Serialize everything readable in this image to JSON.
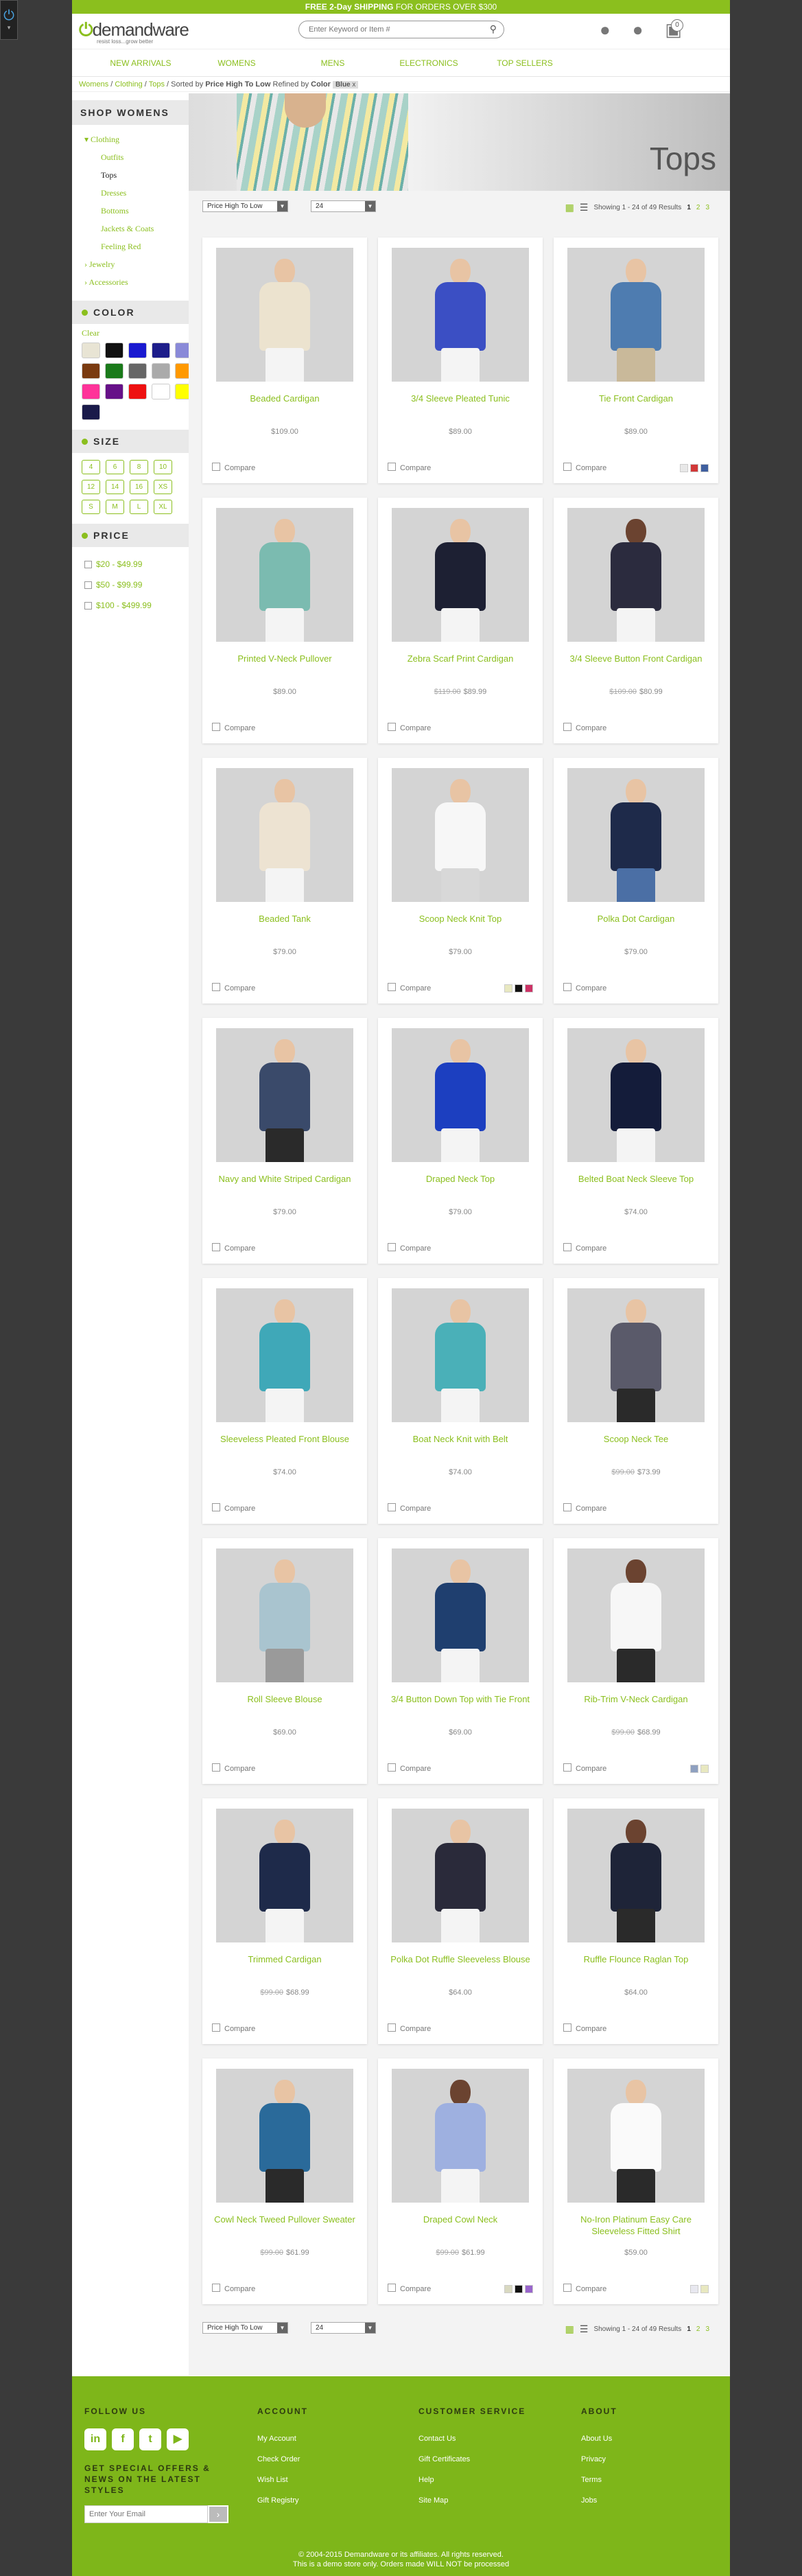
{
  "promo": {
    "bold": "FREE 2-Day SHIPPING",
    "text": " FOR ORDERS OVER $300"
  },
  "logo": {
    "brand": "demandware",
    "tagline": "resist loss...grow better"
  },
  "search": {
    "placeholder": "Enter Keyword or Item #"
  },
  "cart": {
    "count": "0"
  },
  "nav": [
    "NEW ARRIVALS",
    "WOMENS",
    "MENS",
    "ELECTRONICS",
    "TOP SELLERS"
  ],
  "breadcrumb": {
    "items": [
      "Womens",
      "Clothing",
      "Tops"
    ],
    "sorted_label": "Sorted by",
    "sorted_value": "Price High To Low",
    "refined_label": "Refined by",
    "refined_key": "Color",
    "refined_value": "Blue",
    "chip_x": "x"
  },
  "sidebar": {
    "heading": "SHOP WOMENS",
    "clothing": "Clothing",
    "sub": [
      "Outfits",
      "Tops",
      "Dresses",
      "Bottoms",
      "Jackets & Coats",
      "Feeling Red"
    ],
    "jewelry": "Jewelry",
    "accessories": "Accessories",
    "color_heading": "COLOR",
    "clear": "Clear",
    "colors": [
      "#e8e4d4",
      "#111111",
      "#1a1ad0",
      "#1e1e8a",
      "#8a8ad8",
      "#7a3a10",
      "#1a7a1a",
      "#666666",
      "#aaaaaa",
      "#ff9900",
      "#ff3399",
      "#661188",
      "#ee1111",
      "#ffffff",
      "#ffff00",
      "#1a1a4a"
    ],
    "size_heading": "SIZE",
    "sizes": [
      "4",
      "6",
      "8",
      "10",
      "12",
      "14",
      "16",
      "XS",
      "S",
      "M",
      "L",
      "XL"
    ],
    "price_heading": "PRICE",
    "prices": [
      "$20 - $49.99",
      "$50 - $99.99",
      "$100 - $499.99"
    ]
  },
  "banner": {
    "title": "Tops"
  },
  "toolbar": {
    "sort": "Price High To Low",
    "per_page": "24",
    "showing": "Showing 1 - 24 of 49 Results",
    "page_current": "1",
    "pages": [
      "2",
      "3"
    ]
  },
  "compare_label": "Compare",
  "products": [
    {
      "name": "Beaded Cardigan",
      "old": "",
      "price": "$109.00",
      "top": "#ece3cf",
      "bottom": "#f4f4f4",
      "skin": "#e8c4a4",
      "minis": []
    },
    {
      "name": "3/4 Sleeve Pleated Tunic",
      "old": "",
      "price": "$89.00",
      "top": "#3b4fc4",
      "bottom": "#f4f4f4",
      "skin": "#e8c4a4",
      "minis": []
    },
    {
      "name": "Tie Front Cardigan",
      "old": "",
      "price": "$89.00",
      "top": "#4e7cb0",
      "bottom": "#c9b99a",
      "skin": "#e8c4a4",
      "minis": [
        "#e8e8e8",
        "#d13838",
        "#3f5f9f"
      ]
    },
    {
      "name": "Printed V-Neck Pullover",
      "old": "",
      "price": "$89.00",
      "top": "#7bbbb0",
      "bottom": "#f4f4f4",
      "skin": "#e8c4a4",
      "minis": []
    },
    {
      "name": "Zebra Scarf Print Cardigan",
      "old": "$119.00",
      "price": "$89.99",
      "top": "#1d2033",
      "bottom": "#f4f4f4",
      "skin": "#e8c4a4",
      "minis": []
    },
    {
      "name": "3/4 Sleeve Button Front Cardigan",
      "old": "$109.00",
      "price": "$80.99",
      "top": "#2b2b3e",
      "bottom": "#f4f4f4",
      "skin": "#6b4330",
      "minis": []
    },
    {
      "name": "Beaded Tank",
      "old": "",
      "price": "$79.00",
      "top": "#ede3d2",
      "bottom": "#f4f4f4",
      "skin": "#e8c4a4",
      "minis": []
    },
    {
      "name": "Scoop Neck Knit Top",
      "old": "",
      "price": "$79.00",
      "top": "#f7f7f7",
      "bottom": "#d8d8d8",
      "skin": "#e8c4a4",
      "minis": [
        "#e8e8c0",
        "#111111",
        "#cc3366"
      ]
    },
    {
      "name": "Polka Dot Cardigan",
      "old": "",
      "price": "$79.00",
      "top": "#1e2a4a",
      "bottom": "#4b6fa5",
      "skin": "#e8c4a4",
      "minis": []
    },
    {
      "name": "Navy and White Striped Cardigan",
      "old": "",
      "price": "$79.00",
      "top": "#3a4a6a",
      "bottom": "#2a2a2a",
      "skin": "#e8c4a4",
      "minis": []
    },
    {
      "name": "Draped Neck Top",
      "old": "",
      "price": "$79.00",
      "top": "#1c3fc0",
      "bottom": "#f4f4f4",
      "skin": "#e8c4a4",
      "minis": []
    },
    {
      "name": "Belted Boat Neck Sleeve Top",
      "old": "",
      "price": "$74.00",
      "top": "#141c3a",
      "bottom": "#f4f4f4",
      "skin": "#e8c4a4",
      "minis": []
    },
    {
      "name": "Sleeveless Pleated Front Blouse",
      "old": "",
      "price": "$74.00",
      "top": "#3fa8b8",
      "bottom": "#f4f4f4",
      "skin": "#e8c4a4",
      "minis": []
    },
    {
      "name": "Boat Neck Knit with Belt",
      "old": "",
      "price": "$74.00",
      "top": "#4ab0b8",
      "bottom": "#f4f4f4",
      "skin": "#e8c4a4",
      "minis": []
    },
    {
      "name": "Scoop Neck Tee",
      "old": "$99.00",
      "price": "$73.99",
      "top": "#5a5a6a",
      "bottom": "#2a2a2a",
      "skin": "#e8c4a4",
      "minis": []
    },
    {
      "name": "Roll Sleeve Blouse",
      "old": "",
      "price": "$69.00",
      "top": "#a9c4cf",
      "bottom": "#9a9a9a",
      "skin": "#e8c4a4",
      "minis": []
    },
    {
      "name": "3/4 Button Down Top with Tie Front",
      "old": "",
      "price": "$69.00",
      "top": "#1f3f6f",
      "bottom": "#f4f4f4",
      "skin": "#e8c4a4",
      "minis": []
    },
    {
      "name": "Rib-Trim V-Neck Cardigan",
      "old": "$99.00",
      "price": "$68.99",
      "top": "#f7f7f7",
      "bottom": "#2a2a2a",
      "skin": "#6b4330",
      "minis": [
        "#8ea0c0",
        "#e8e8c0"
      ]
    },
    {
      "name": "Trimmed Cardigan",
      "old": "$99.00",
      "price": "$68.99",
      "top": "#1e2a4a",
      "bottom": "#f4f4f4",
      "skin": "#e8c4a4",
      "minis": []
    },
    {
      "name": "Polka Dot Ruffle Sleeveless Blouse",
      "old": "",
      "price": "$64.00",
      "top": "#2a2a3a",
      "bottom": "#f4f4f4",
      "skin": "#e8c4a4",
      "minis": []
    },
    {
      "name": "Ruffle Flounce Raglan Top",
      "old": "",
      "price": "$64.00",
      "top": "#1e2438",
      "bottom": "#2a2a2a",
      "skin": "#6b4330",
      "minis": []
    },
    {
      "name": "Cowl Neck Tweed Pullover Sweater",
      "old": "$99.00",
      "price": "$61.99",
      "top": "#2a6a9a",
      "bottom": "#2a2a2a",
      "skin": "#e8c4a4",
      "minis": []
    },
    {
      "name": "Draped Cowl Neck",
      "old": "$99.00",
      "price": "$61.99",
      "top": "#9eb0e0",
      "bottom": "#f4f4f4",
      "skin": "#6b4330",
      "minis": [
        "#d8d8c0",
        "#111111",
        "#9966cc"
      ]
    },
    {
      "name": "No-Iron Platinum Easy Care Sleeveless Fitted Shirt",
      "old": "",
      "price": "$59.00",
      "top": "#fafafa",
      "bottom": "#2a2a2a",
      "skin": "#e8c4a4",
      "minis": [
        "#e8e8f0",
        "#e8e8c0"
      ]
    }
  ],
  "footer": {
    "follow": "FOLLOW US",
    "social": [
      "in",
      "f",
      "t",
      "▶"
    ],
    "signup": "GET SPECIAL OFFERS & NEWS ON THE LATEST STYLES",
    "email_placeholder": "Enter Your Email",
    "account_heading": "ACCOUNT",
    "account": [
      "My Account",
      "Check Order",
      "Wish List",
      "Gift Registry"
    ],
    "service_heading": "CUSTOMER SERVICE",
    "service": [
      "Contact Us",
      "Gift Certificates",
      "Help",
      "Site Map"
    ],
    "about_heading": "ABOUT",
    "about": [
      "About Us",
      "Privacy",
      "Terms",
      "Jobs"
    ],
    "copyright": "© 2004-2015 Demandware or its affiliates. All rights reserved.",
    "demo": "This is a demo store only. Orders made WILL NOT be processed"
  }
}
